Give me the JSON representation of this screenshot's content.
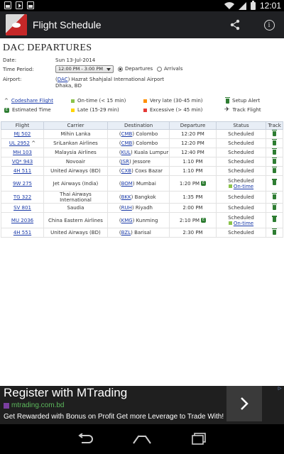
{
  "status_bar": {
    "time": "12:01",
    "left_icons": [
      "picture-icon",
      "play-icon",
      "image-icon"
    ],
    "right_icons": [
      "wifi-icon",
      "signal-icon",
      "battery-icon"
    ]
  },
  "app_bar": {
    "title": "Flight Schedule",
    "actions": [
      "share-icon",
      "info-icon"
    ]
  },
  "page": {
    "title": "DAC DEPARTURES",
    "date_label": "Date:",
    "date_value": "Sun 13-Jul-2014",
    "period_label": "Time Period:",
    "period_value": "12:00 PM - 3:00 PM",
    "radio_departures": "Departures",
    "radio_arrivals": "Arrivals",
    "airport_label": "Airport:",
    "airport_code": "DAC",
    "airport_name": "Hazrat Shahjalal International Airport",
    "airport_city": "Dhaka, BD"
  },
  "legend": {
    "codeshare_prefix": "^",
    "codeshare": "Codeshare Flight",
    "ontime": "On-time (< 15 min)",
    "very_late": "Very late (30-45 min)",
    "setup_alert": "Setup Alert",
    "estimated": "Estimated Time",
    "late": "Late (15-29 min)",
    "excessive": "Excessive (> 45 min)",
    "track_flight": "Track Flight",
    "colors": {
      "ontime": "#8bc34a",
      "late": "#ffd600",
      "very_late": "#ff8f00",
      "excessive": "#e53935",
      "track": "#2e7d32"
    }
  },
  "table": {
    "headers": [
      "Flight",
      "Carrier",
      "Destination",
      "Departure",
      "Status",
      "Track"
    ],
    "rows": [
      {
        "flight": "MJ 502",
        "carrier": "Mihin Lanka",
        "code": "CMB",
        "city": "Colombo",
        "departure": "12:20 PM",
        "status": "Scheduled"
      },
      {
        "flight": "UL 2952",
        "codeshare": "^",
        "carrier": "SriLankan Airlines",
        "code": "CMB",
        "city": "Colombo",
        "departure": "12:20 PM",
        "status": "Scheduled"
      },
      {
        "flight": "MH 103",
        "carrier": "Malaysia Airlines",
        "code": "KUL",
        "city": "Kuala Lumpur",
        "departure": "12:40 PM",
        "status": "Scheduled"
      },
      {
        "flight": "VQ* 943",
        "carrier": "Novoair",
        "code": "JSR",
        "city": "Jessore",
        "departure": "1:10 PM",
        "status": "Scheduled"
      },
      {
        "flight": "4H 511",
        "carrier": "United Airways (BD)",
        "code": "CXB",
        "city": "Coxs Bazar",
        "departure": "1:10 PM",
        "status": "Scheduled"
      },
      {
        "flight": "9W 275",
        "carrier": "Jet Airways (India)",
        "code": "BOM",
        "city": "Mumbai",
        "departure": "1:20 PM",
        "estimated": "E",
        "status": "Scheduled",
        "ontime": "On-time"
      },
      {
        "flight": "TG 322",
        "carrier": "Thai Airways International",
        "code": "BKK",
        "city": "Bangkok",
        "departure": "1:35 PM",
        "status": "Scheduled"
      },
      {
        "flight": "SV 801",
        "carrier": "Saudia",
        "code": "RUH",
        "city": "Riyadh",
        "departure": "2:00 PM",
        "status": "Scheduled"
      },
      {
        "flight": "MU 2036",
        "carrier": "China Eastern Airlines",
        "code": "KMG",
        "city": "Kunming",
        "departure": "2:10 PM",
        "estimated": "E",
        "status": "Scheduled",
        "ontime": "On-time"
      },
      {
        "flight": "4H 551",
        "carrier": "United Airways (BD)",
        "code": "BZL",
        "city": "Barisal",
        "departure": "2:30 PM",
        "status": "Scheduled"
      }
    ]
  },
  "ad": {
    "title": "Register with MTrading",
    "domain": "mtrading.com.bd",
    "description": "Get Rewarded with Bonus on Profit Get more Leverage to Trade With!",
    "next_icon": "chevron-right-icon"
  },
  "nav_bar": {
    "buttons": [
      "back-icon",
      "home-icon",
      "recents-icon"
    ]
  }
}
